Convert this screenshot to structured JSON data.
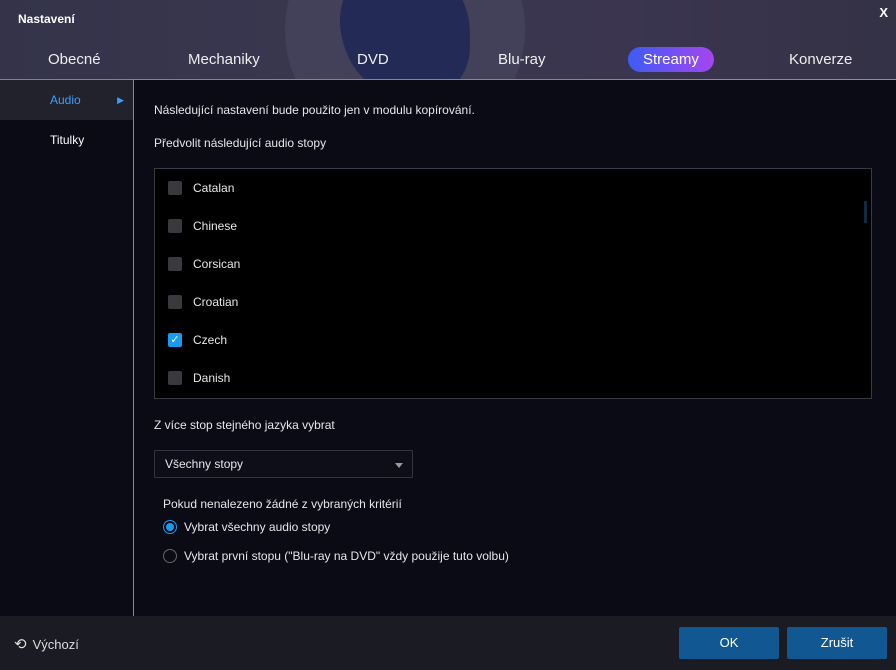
{
  "window": {
    "title": "Nastavení",
    "close": "X"
  },
  "tabs": [
    "Obecné",
    "Mechaniky",
    "DVD",
    "Blu-ray",
    "Streamy",
    "Konverze"
  ],
  "sidebar": {
    "items": [
      "Audio",
      "Titulky"
    ],
    "active_arrow": "▶"
  },
  "main": {
    "note": "Následující nastavení bude použito jen v modulu kopírování.",
    "list_label": "Předvolit následující audio stopy",
    "languages": [
      {
        "label": "Catalan",
        "checked": false
      },
      {
        "label": "Chinese",
        "checked": false
      },
      {
        "label": "Corsican",
        "checked": false
      },
      {
        "label": "Croatian",
        "checked": false
      },
      {
        "label": "Czech",
        "checked": true
      },
      {
        "label": "Danish",
        "checked": false
      }
    ],
    "multi_label": "Z více stop stejného jazyka vybrat",
    "select_value": "Všechny stopy",
    "fallback_label": "Pokud nenalezeno žádné z vybraných kritérií",
    "radio1": "Vybrat všechny audio stopy",
    "radio2": "Vybrat první stopu (\"Blu-ray na DVD\" vždy použije tuto volbu)"
  },
  "footer": {
    "reset": "Výchozí",
    "ok": "OK",
    "cancel": "Zrušit"
  }
}
